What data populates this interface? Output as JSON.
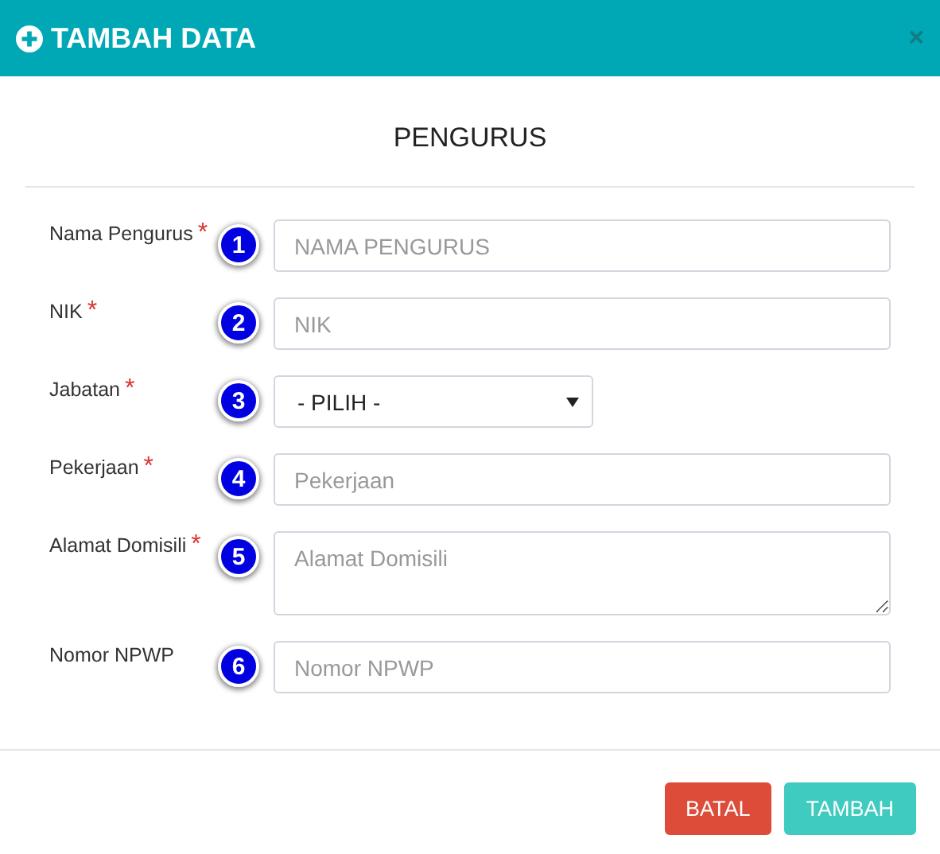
{
  "window": {
    "title": "TAMBAH DATA",
    "close": "×"
  },
  "section_title": "PENGURUS",
  "fields": [
    {
      "label": "Nama Pengurus",
      "required_mark": "*",
      "marker": "1",
      "kind": "input",
      "placeholder": "NAMA PENGURUS"
    },
    {
      "label": "NIK",
      "required_mark": "*",
      "marker": "2",
      "kind": "input",
      "placeholder": "NIK"
    },
    {
      "label": "Jabatan",
      "required_mark": "*",
      "marker": "3",
      "kind": "select",
      "value": "- PILIH -"
    },
    {
      "label": "Pekerjaan",
      "required_mark": "*",
      "marker": "4",
      "kind": "input",
      "placeholder": "Pekerjaan"
    },
    {
      "label": "Alamat Domisili",
      "required_mark": "*",
      "marker": "5",
      "kind": "textarea",
      "placeholder": "Alamat Domisili"
    },
    {
      "label": "Nomor NPWP",
      "marker": "6",
      "kind": "input",
      "placeholder": "Nomor NPWP"
    }
  ],
  "buttons": [
    {
      "label": "BATAL",
      "kind": "cancel"
    },
    {
      "label": "TAMBAH",
      "kind": "primary"
    }
  ]
}
